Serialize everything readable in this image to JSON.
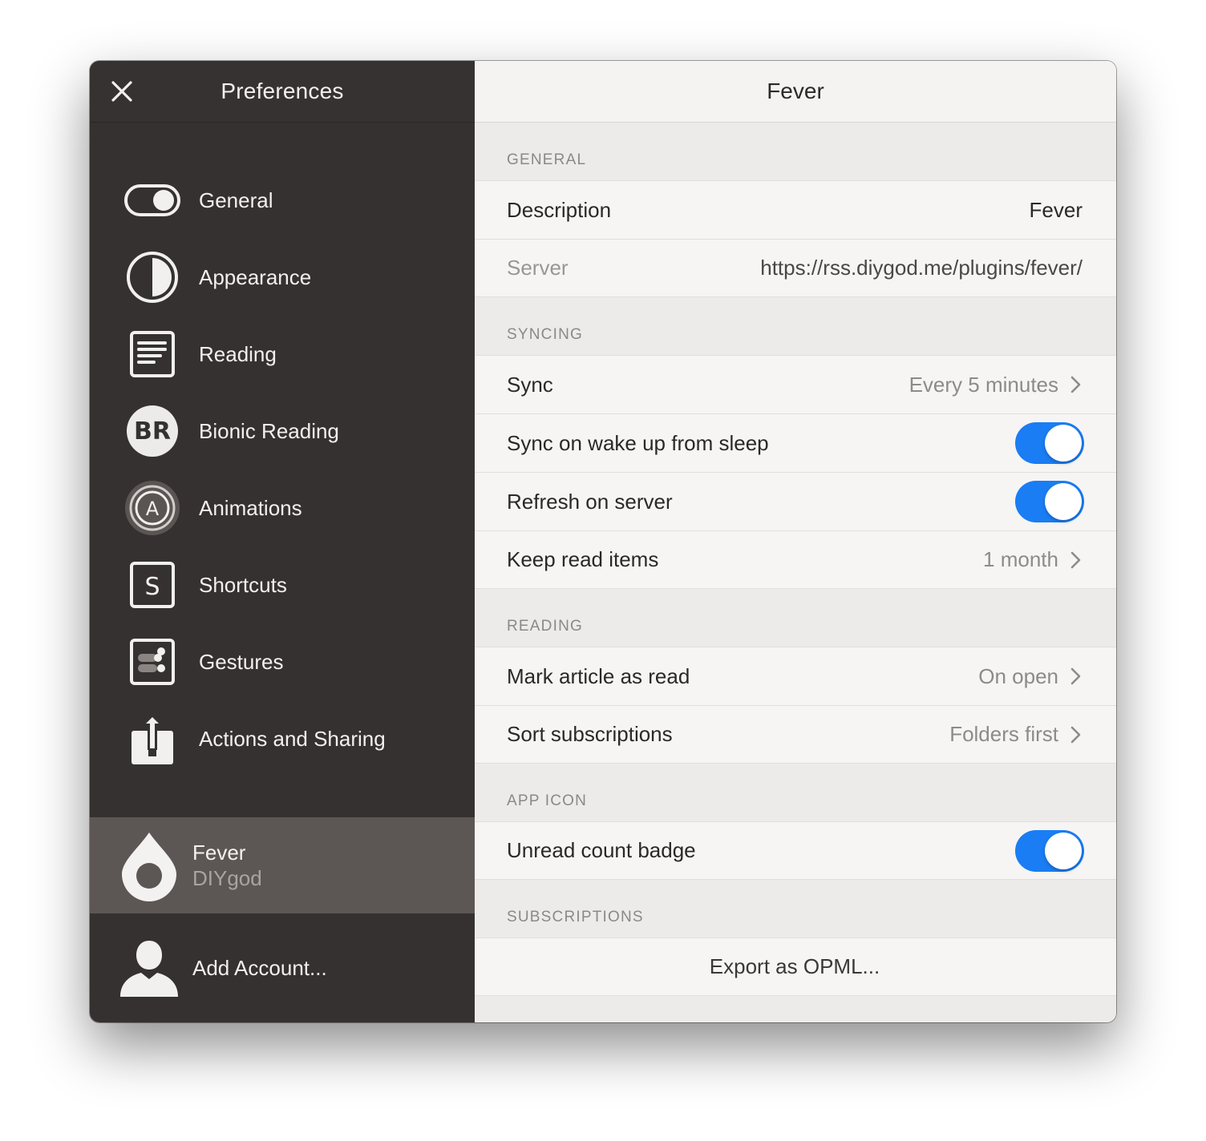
{
  "sidebar": {
    "title": "Preferences",
    "items": [
      {
        "label": "General",
        "icon": "toggle-icon"
      },
      {
        "label": "Appearance",
        "icon": "half-circle-icon"
      },
      {
        "label": "Reading",
        "icon": "document-lines-icon"
      },
      {
        "label": "Bionic Reading",
        "icon": "br-badge-icon"
      },
      {
        "label": "Animations",
        "icon": "a-circle-icon"
      },
      {
        "label": "Shortcuts",
        "icon": "s-square-icon"
      },
      {
        "label": "Gestures",
        "icon": "gesture-dots-icon"
      },
      {
        "label": "Actions and Sharing",
        "icon": "share-icon"
      }
    ],
    "account": {
      "name": "Fever",
      "user": "DIYgod"
    },
    "add_account": "Add Account..."
  },
  "main": {
    "title": "Fever",
    "sections": {
      "general": {
        "header": "GENERAL",
        "description_label": "Description",
        "description_value": "Fever",
        "server_label": "Server",
        "server_value": "https://rss.diygod.me/plugins/fever/"
      },
      "syncing": {
        "header": "SYNCING",
        "sync_label": "Sync",
        "sync_value": "Every 5 minutes",
        "wake_label": "Sync on wake up from sleep",
        "wake_on": true,
        "refresh_label": "Refresh on server",
        "refresh_on": true,
        "keep_label": "Keep read items",
        "keep_value": "1 month"
      },
      "reading": {
        "header": "READING",
        "mark_label": "Mark article as read",
        "mark_value": "On open",
        "sort_label": "Sort subscriptions",
        "sort_value": "Folders first"
      },
      "app_icon": {
        "header": "APP ICON",
        "badge_label": "Unread count badge",
        "badge_on": true
      },
      "subscriptions": {
        "header": "SUBSCRIPTIONS",
        "export_label": "Export as OPML..."
      }
    }
  },
  "colors": {
    "accent": "#1a7df4",
    "sidebar_bg": "#353130",
    "account_bg": "#5c5755"
  }
}
